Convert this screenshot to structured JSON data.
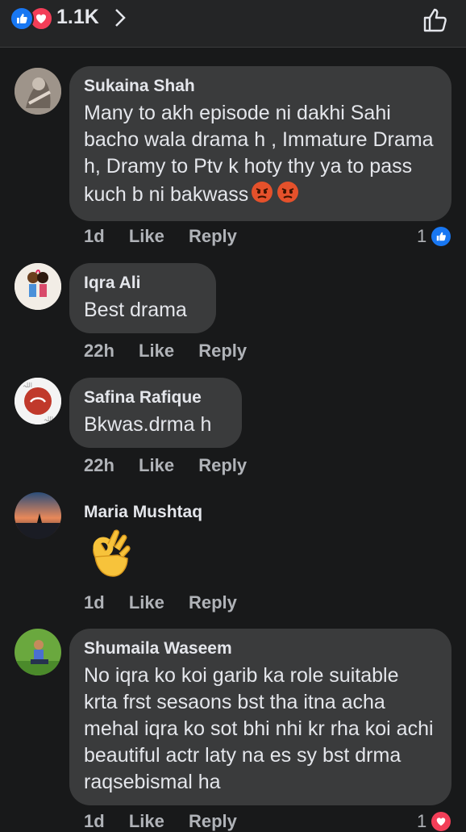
{
  "header": {
    "reaction_count": "1.1K"
  },
  "comments": [
    {
      "name": "Sukaina Shah",
      "text": "Many to akh episode ni dakhi Sahi bacho wala drama h , Immature Drama h, Dramy to Ptv k hoty thy ya to pass kuch b ni bakwass",
      "time": "1d",
      "like": "Like",
      "reply": "Reply",
      "likes": "1"
    },
    {
      "name": "Iqra Ali",
      "text": "Best drama",
      "time": "22h",
      "like": "Like",
      "reply": "Reply"
    },
    {
      "name": "Safina Rafique",
      "text": "Bkwas.drma h",
      "time": "22h",
      "like": "Like",
      "reply": "Reply"
    },
    {
      "name": "Maria Mushtaq",
      "text": "",
      "time": "1d",
      "like": "Like",
      "reply": "Reply"
    },
    {
      "name": "Shumaila Waseem",
      "text": "No iqra ko koi garib ka role suitable krta frst sesaons bst tha itna acha mehal iqra ko sot bhi nhi kr rha koi achi beautiful actr laty na es sy bst drma raqsebismal ha",
      "time": "1d",
      "like": "Like",
      "reply": "Reply",
      "likes": "1"
    }
  ],
  "colors": {
    "background": "#18191a",
    "bubble": "#3a3b3c",
    "like_blue": "#1877f2",
    "love_red": "#f33e58",
    "meta": "#b0b3b8"
  }
}
